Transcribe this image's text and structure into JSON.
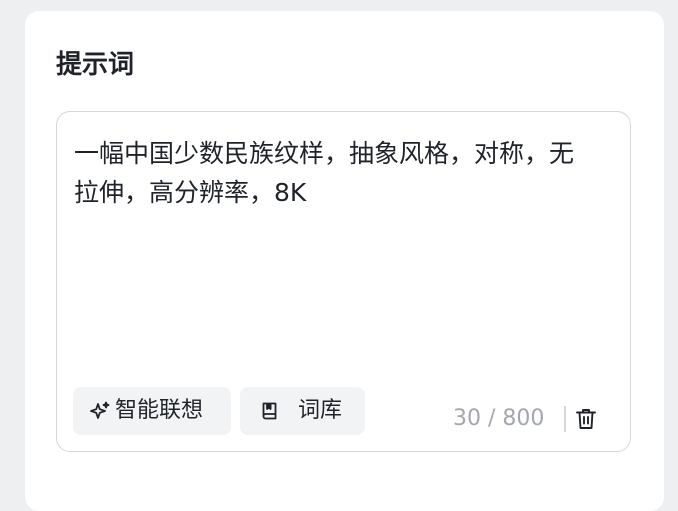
{
  "section": {
    "title": "提示词"
  },
  "prompt": {
    "text": "一幅中国少数民族纹样，抽象风格，对称，无拉伸，高分辨率，8K",
    "char_count": "30 / 800"
  },
  "toolbar": {
    "associate_label": "智能联想",
    "associate_icon": "sparkle-icon",
    "library_label": "词库",
    "library_icon": "book-icon",
    "clear_icon": "trash-icon"
  }
}
